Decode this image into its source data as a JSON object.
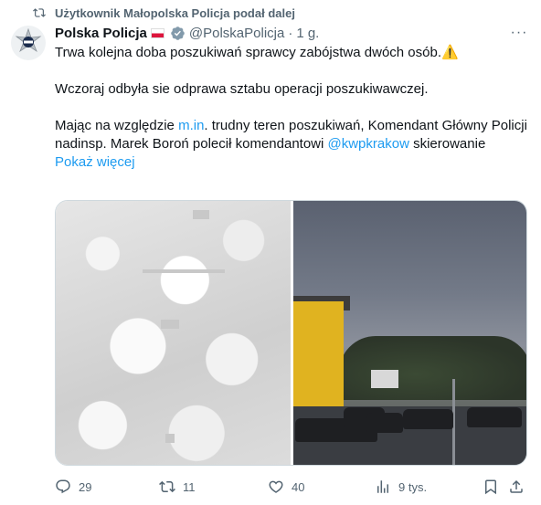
{
  "repost": {
    "text": "Użytkownik Małopolska Policja podał dalej",
    "icon": "repost-icon"
  },
  "post": {
    "author_name": "Polska Policja",
    "handle": "@PolskaPolicja",
    "separator": "·",
    "time": "1 g.",
    "more_label": "···",
    "line1": "Trwa kolejna doba poszukiwań sprawcy zabójstwa dwóch osób.",
    "warning_emoji": "⚠️",
    "line2": "Wczoraj odbyła sie odprawa sztabu operacji poszukiwawczej.",
    "line3_prefix": "Mając na względzie ",
    "line3_link": "m.in",
    "line3_rest": ". trudny teren poszukiwań, Komendant Główny Policji nadinsp. Marek Boroń polecił komendantowi ",
    "mention": "@kwpkrakow",
    "line3_end": " skierowanie",
    "show_more": "Pokaż więcej"
  },
  "actions": {
    "reply_count": "29",
    "repost_count": "11",
    "like_count": "40",
    "views_count": "9 tys."
  },
  "colors": {
    "accent": "#1d9bf0",
    "muted": "#536471",
    "text": "#0f1419"
  }
}
